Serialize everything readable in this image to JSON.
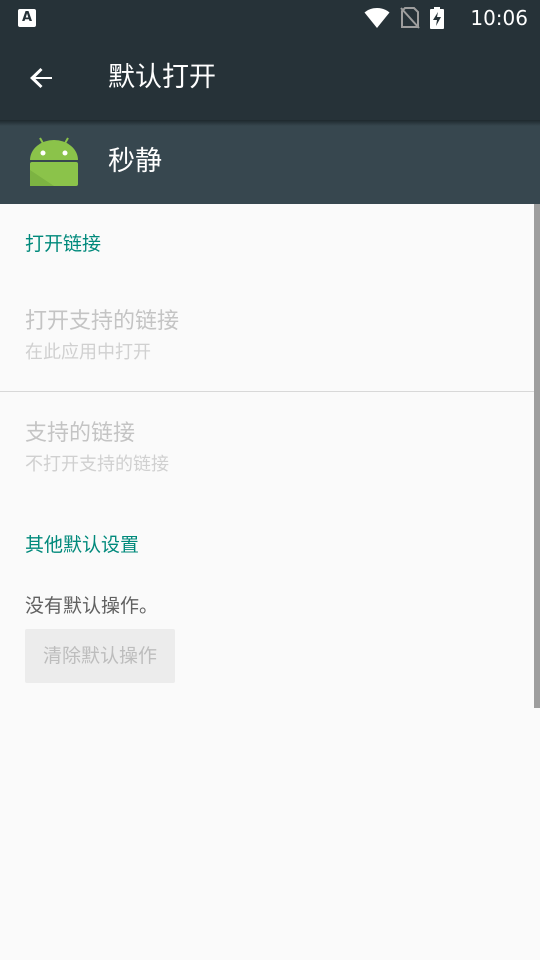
{
  "status_bar": {
    "notification_glyph": "A",
    "time": "10:06",
    "icons": [
      "wifi-icon",
      "no-sim-icon",
      "battery-charging-icon"
    ]
  },
  "app_bar": {
    "title": "默认打开"
  },
  "app_header": {
    "app_name": "秒静",
    "icon_color": "#8bc34a"
  },
  "sections": {
    "open_links": {
      "title": "打开链接",
      "open_supported": {
        "title": "打开支持的链接",
        "subtitle": "在此应用中打开"
      },
      "supported_links": {
        "title": "支持的链接",
        "subtitle": "不打开支持的链接"
      }
    },
    "other_defaults": {
      "title": "其他默认设置",
      "message": "没有默认操作。",
      "clear_button": "清除默认操作"
    }
  },
  "colors": {
    "toolbar": "#263238",
    "header": "#37474f",
    "accent": "#00897b"
  }
}
